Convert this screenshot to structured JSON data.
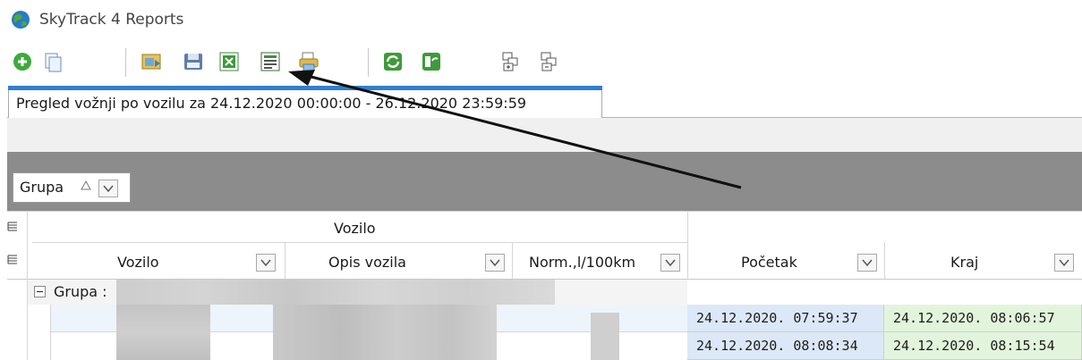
{
  "window": {
    "title": "SkyTrack 4 Reports",
    "icon": "globe-app-icon"
  },
  "toolbar": {
    "buttons": [
      {
        "icon": "add-icon"
      },
      {
        "icon": "copy-icon"
      },
      {
        "icon": "open-report-icon"
      },
      {
        "icon": "save-icon"
      },
      {
        "icon": "export-excel-icon"
      },
      {
        "icon": "export-table-icon"
      },
      {
        "icon": "print-icon"
      },
      {
        "icon": "refresh-icon"
      },
      {
        "icon": "refresh-all-icon"
      },
      {
        "icon": "expand-all-icon"
      },
      {
        "icon": "collapse-all-icon"
      }
    ]
  },
  "tab": {
    "label": "Pregled vožnji po vozilu za 24.12.2020 00:00:00 - 26.12.2020 23:59:59",
    "accent": "#2f7fd1"
  },
  "group_panel": {
    "chip_label": "Grupa"
  },
  "grid": {
    "band_label": "Vozilo",
    "columns": [
      "Vozilo",
      "Opis vozila",
      "Norm.,l/100km",
      "Početak",
      "Kraj"
    ],
    "group_row_label": "Grupa :",
    "rows": [
      {
        "start": "24.12.2020. 07:59:37",
        "end": "24.12.2020. 08:06:57"
      },
      {
        "start": "24.12.2020. 08:08:34",
        "end": "24.12.2020. 08:15:54"
      }
    ]
  },
  "colors": {
    "start_cell_bg": "#dce8f7",
    "end_cell_bg": "#e2f5dc",
    "group_panel_bg": "#8c8c8c"
  }
}
